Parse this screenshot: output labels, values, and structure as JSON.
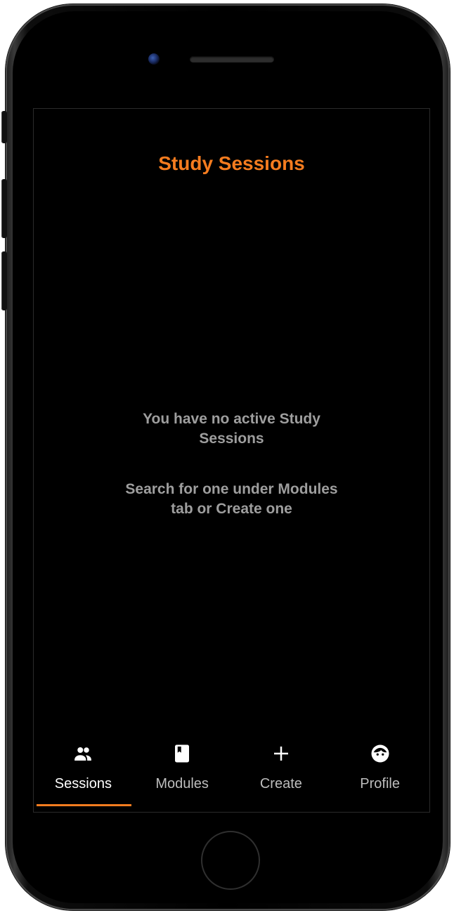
{
  "header": {
    "title": "Study Sessions"
  },
  "empty_state": {
    "line1": "You have no active Study",
    "line2": "Sessions",
    "line3": "Search for one under Modules",
    "line4": "tab or Create one"
  },
  "tabs": [
    {
      "label": "Sessions",
      "icon": "people-icon",
      "active": true
    },
    {
      "label": "Modules",
      "icon": "book-icon",
      "active": false
    },
    {
      "label": "Create",
      "icon": "plus-icon",
      "active": false
    },
    {
      "label": "Profile",
      "icon": "face-icon",
      "active": false
    }
  ],
  "colors": {
    "accent": "#f57c1f",
    "background": "#000000",
    "muted_text": "#9e9e9e",
    "active_tab_text": "#ffffff",
    "inactive_tab_text": "#bdbdbd"
  }
}
